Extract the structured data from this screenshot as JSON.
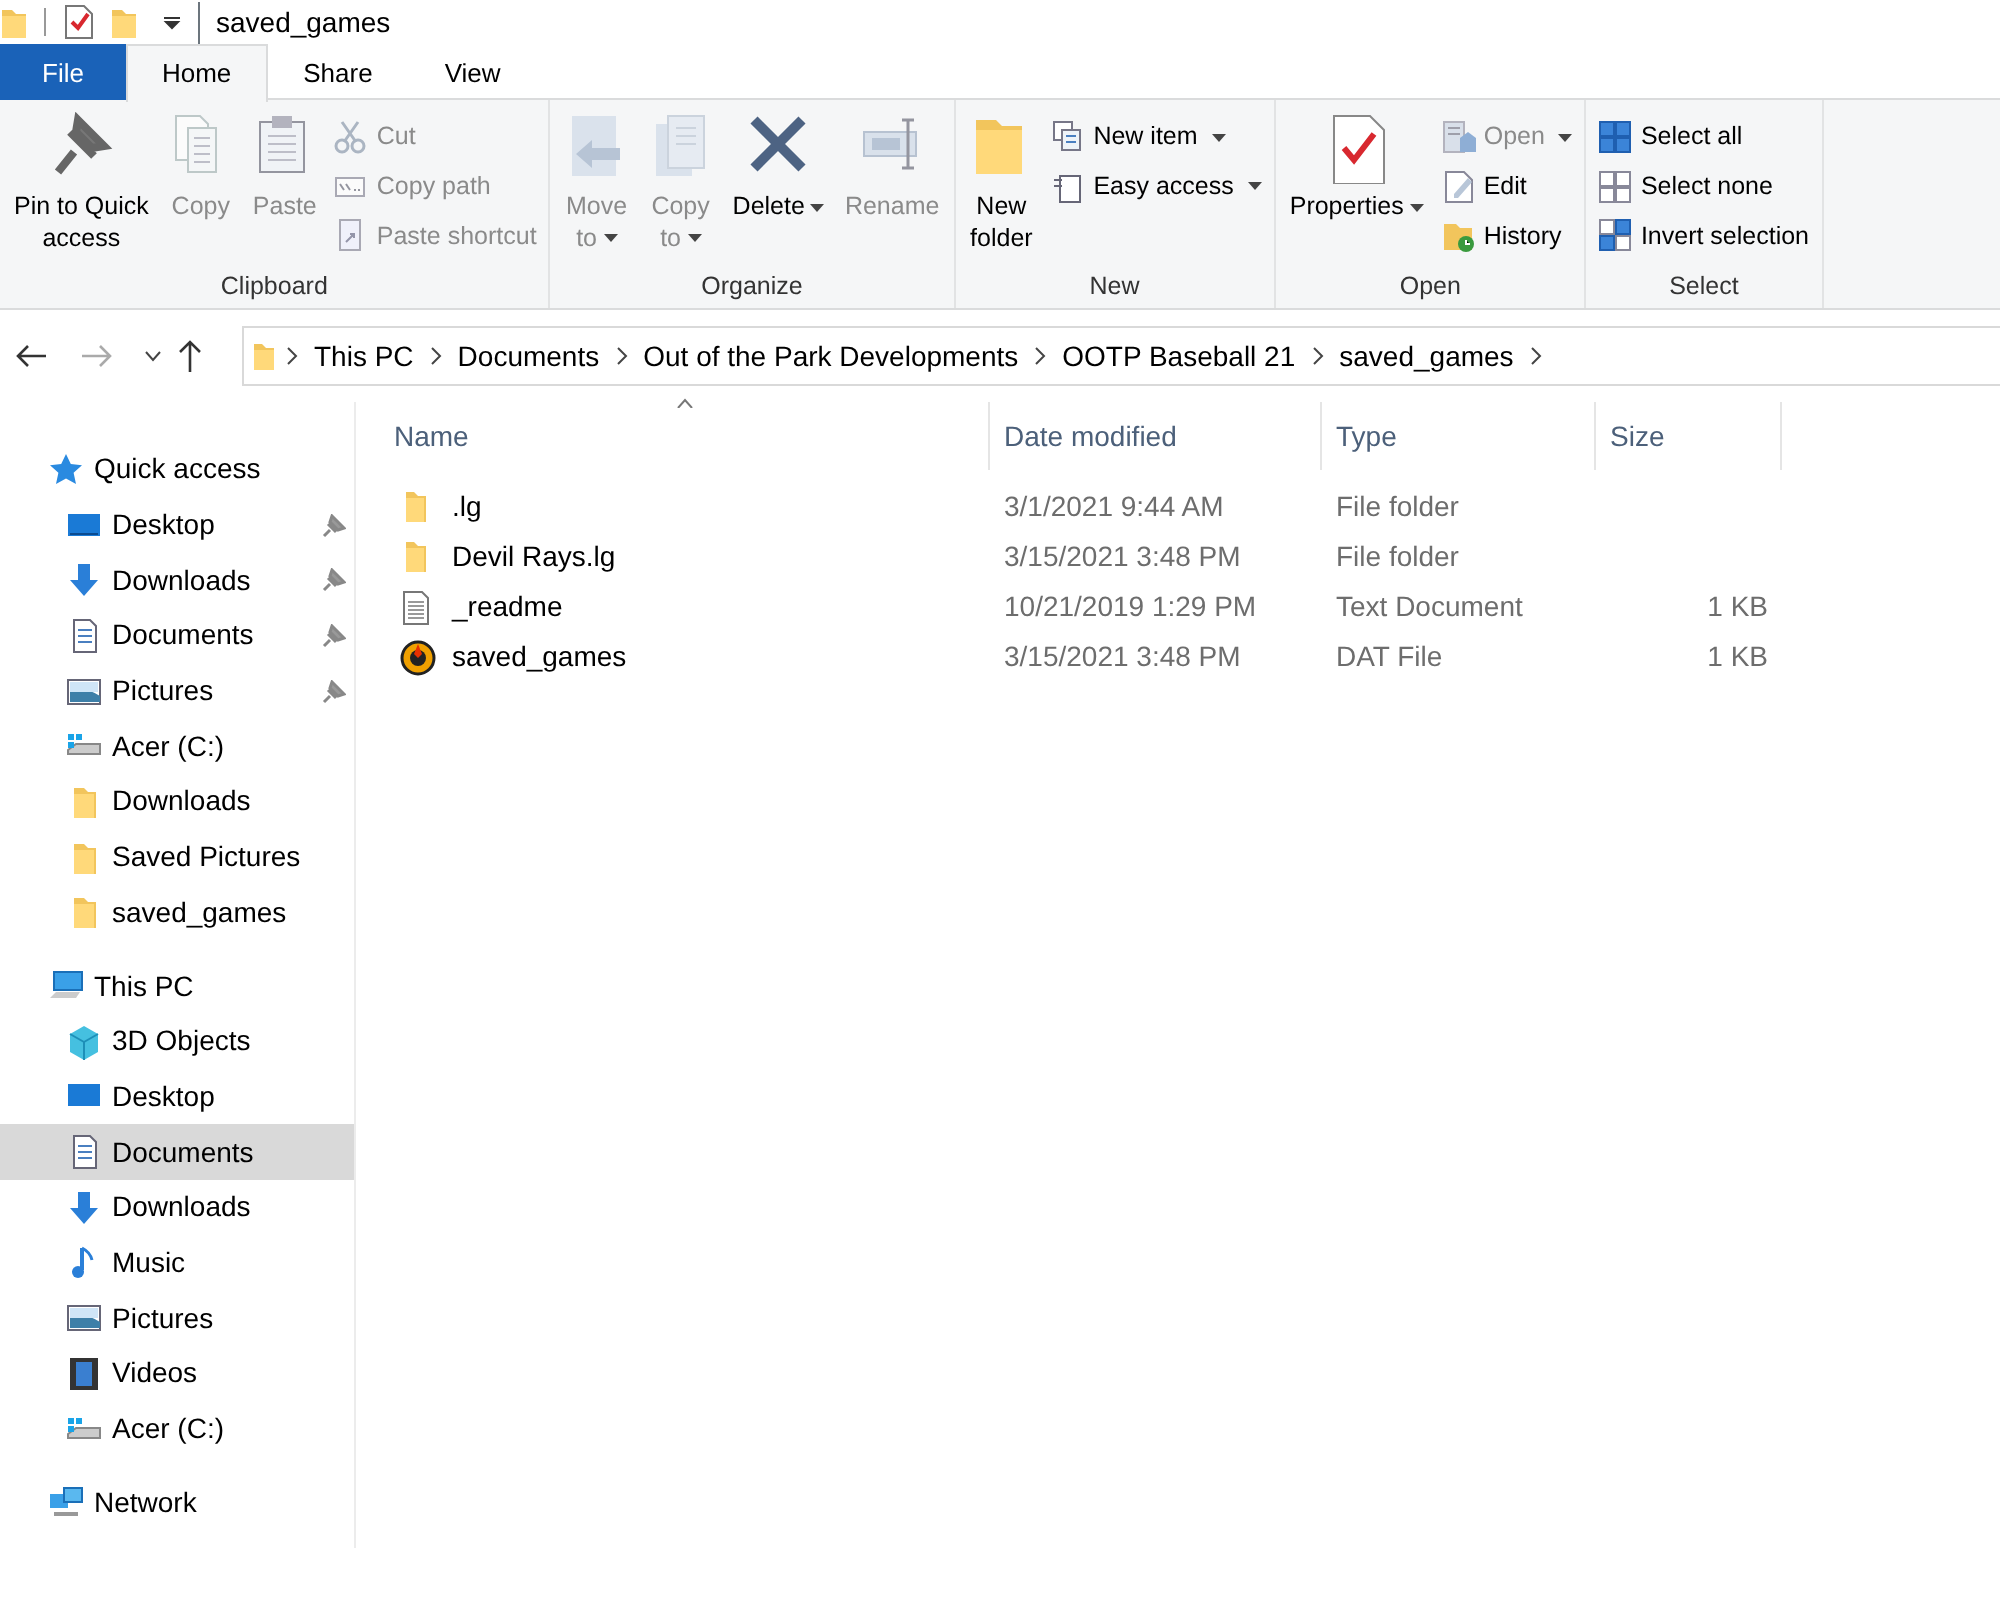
{
  "window": {
    "title": "saved_games"
  },
  "tabs": [
    {
      "label": "File",
      "kind": "file",
      "selected": false
    },
    {
      "label": "Home",
      "kind": "tab",
      "selected": true
    },
    {
      "label": "Share",
      "kind": "tab",
      "selected": false
    },
    {
      "label": "View",
      "kind": "tab",
      "selected": false
    }
  ],
  "ribbon_groups": [
    {
      "label": "Clipboard",
      "items": [
        {
          "kind": "large",
          "label": "Pin to Quick\naccess",
          "disabled": false,
          "dropdown": false
        },
        {
          "kind": "large",
          "label": "Copy",
          "disabled": true,
          "dropdown": false
        },
        {
          "kind": "large",
          "label": "Paste",
          "disabled": true,
          "dropdown": false
        },
        {
          "kind": "small",
          "label": "Cut",
          "disabled": true,
          "dropdown": false
        },
        {
          "kind": "small",
          "label": "Copy path",
          "disabled": true,
          "dropdown": false
        },
        {
          "kind": "small",
          "label": "Paste shortcut",
          "disabled": true,
          "dropdown": false
        }
      ]
    },
    {
      "label": "Organize",
      "items": [
        {
          "kind": "large",
          "label": "Move\nto",
          "disabled": true,
          "dropdown": true
        },
        {
          "kind": "large",
          "label": "Copy\nto",
          "disabled": true,
          "dropdown": true
        },
        {
          "kind": "large",
          "label": "Delete",
          "disabled": false,
          "dropdown": true
        },
        {
          "kind": "large",
          "label": "Rename",
          "disabled": true,
          "dropdown": false
        }
      ]
    },
    {
      "label": "New",
      "items": [
        {
          "kind": "large",
          "label": "New\nfolder",
          "disabled": false,
          "dropdown": false
        },
        {
          "kind": "small",
          "label": "New item",
          "disabled": false,
          "dropdown": true
        },
        {
          "kind": "small",
          "label": "Easy access",
          "disabled": false,
          "dropdown": true
        }
      ]
    },
    {
      "label": "Open",
      "items": [
        {
          "kind": "large",
          "label": "Properties",
          "disabled": false,
          "dropdown": true
        },
        {
          "kind": "small",
          "label": "Open",
          "disabled": true,
          "dropdown": true
        },
        {
          "kind": "small",
          "label": "Edit",
          "disabled": false,
          "dropdown": false
        },
        {
          "kind": "small",
          "label": "History",
          "disabled": false,
          "dropdown": false
        }
      ]
    },
    {
      "label": "Select",
      "items": [
        {
          "kind": "small",
          "label": "Select all",
          "disabled": false,
          "dropdown": false
        },
        {
          "kind": "small",
          "label": "Select none",
          "disabled": false,
          "dropdown": false
        },
        {
          "kind": "small",
          "label": "Invert selection",
          "disabled": false,
          "dropdown": false
        }
      ]
    }
  ],
  "address_bar": {
    "path": [
      "This PC",
      "Documents",
      "Out of the Park Developments",
      "OOTP Baseball 21",
      "saved_games"
    ]
  },
  "sidebar": {
    "sections": [
      {
        "label": "Quick access",
        "selected": false,
        "children": [
          {
            "label": "Desktop",
            "pinned": true,
            "selected": false
          },
          {
            "label": "Downloads",
            "pinned": true,
            "selected": false
          },
          {
            "label": "Documents",
            "pinned": true,
            "selected": false
          },
          {
            "label": "Pictures",
            "pinned": true,
            "selected": false
          },
          {
            "label": "Acer (C:)",
            "pinned": false,
            "selected": false
          },
          {
            "label": "Downloads",
            "pinned": false,
            "selected": false
          },
          {
            "label": "Saved Pictures",
            "pinned": false,
            "selected": false
          },
          {
            "label": "saved_games",
            "pinned": false,
            "selected": false
          }
        ]
      },
      {
        "label": "This PC",
        "selected": false,
        "children": [
          {
            "label": "3D Objects",
            "pinned": false,
            "selected": false
          },
          {
            "label": "Desktop",
            "pinned": false,
            "selected": false
          },
          {
            "label": "Documents",
            "pinned": false,
            "selected": true
          },
          {
            "label": "Downloads",
            "pinned": false,
            "selected": false
          },
          {
            "label": "Music",
            "pinned": false,
            "selected": false
          },
          {
            "label": "Pictures",
            "pinned": false,
            "selected": false
          },
          {
            "label": "Videos",
            "pinned": false,
            "selected": false
          },
          {
            "label": "Acer (C:)",
            "pinned": false,
            "selected": false
          }
        ]
      },
      {
        "label": "Network",
        "selected": false
      }
    ]
  },
  "table": {
    "columns": [
      {
        "label": "Name",
        "sorted": true
      },
      {
        "label": "Date modified",
        "sorted": false
      },
      {
        "label": "Type",
        "sorted": false
      },
      {
        "label": "Size",
        "sorted": false
      }
    ],
    "rows": [
      {
        "kind": "folder",
        "name": ".lg",
        "date": "3/1/2021 9:44 AM",
        "type": "File folder"
      },
      {
        "kind": "folder",
        "name": "Devil Rays.lg",
        "date": "3/15/2021 3:48 PM",
        "type": "File folder"
      },
      {
        "kind": "text",
        "name": "_readme",
        "date": "10/21/2019 1:29 PM",
        "type": "Text Document",
        "size": "1 KB"
      },
      {
        "kind": "app",
        "name": "saved_games",
        "date": "3/15/2021 3:48 PM",
        "type": "DAT File",
        "size": "1 KB"
      }
    ]
  }
}
